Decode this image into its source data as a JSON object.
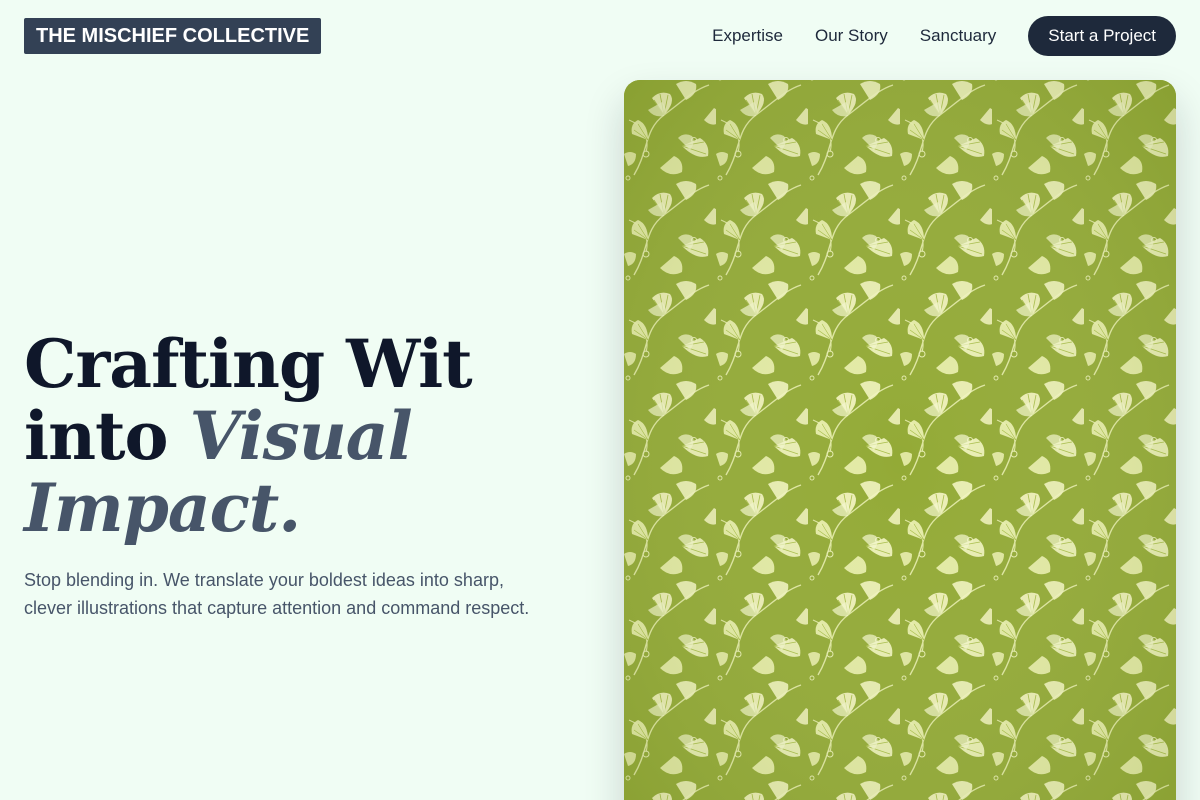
{
  "header": {
    "logo_text": "THE MISCHIEF COLLECTIVE",
    "nav": [
      {
        "label": "Expertise"
      },
      {
        "label": "Our Story"
      },
      {
        "label": "Sanctuary"
      }
    ],
    "cta_label": "Start a Project"
  },
  "hero": {
    "title_line1": "Crafting Wit",
    "title_line2_plain": "into ",
    "title_line2_accent": "Visual",
    "title_line3_accent": "Impact.",
    "subtitle": "Stop blending in. We translate your boldest ideas into sharp, clever illustrations that capture attention and command respect."
  },
  "art": {
    "description_icon": "floral-pattern-image"
  },
  "colors": {
    "background": "#f0fdf4",
    "logo_bg": "#334155",
    "cta_bg": "#1e293b",
    "title_dark": "#0f172a",
    "title_accent": "#475569",
    "pattern_base": "#9aaf3c",
    "pattern_leaf": "#f3f5c2"
  }
}
